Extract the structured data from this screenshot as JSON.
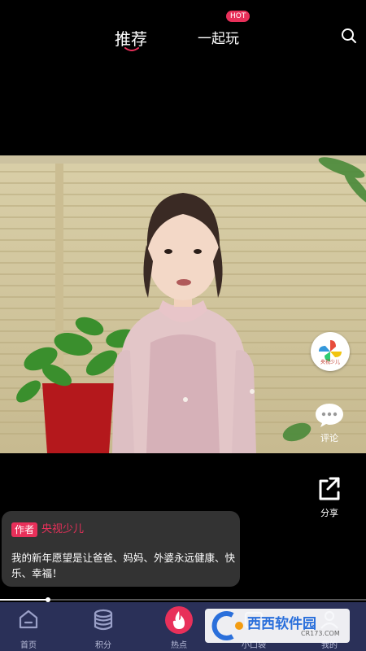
{
  "header": {
    "tabs": [
      {
        "label": "推荐",
        "active": true
      },
      {
        "label": "一起玩",
        "badge": "HOT"
      }
    ]
  },
  "side_actions": {
    "logo_text": "央视少儿",
    "comment_label": "评论",
    "share_label": "分享"
  },
  "caption": {
    "author_tag": "作者",
    "author_name": "央视少儿",
    "text": "我的新年愿望是让爸爸、妈妈、外婆永远健康、快乐、幸福！"
  },
  "playback": {
    "progress": 0.13
  },
  "bottom_nav": {
    "items": [
      {
        "label": "首页",
        "icon": "home-icon"
      },
      {
        "label": "积分",
        "icon": "coins-icon"
      },
      {
        "label": "热点",
        "icon": "fire-icon"
      },
      {
        "label": "小口袋",
        "icon": "pocket-icon"
      },
      {
        "label": "我的",
        "icon": "user-icon"
      }
    ]
  },
  "watermark": {
    "main": "西西软件园",
    "sub": "CR173.COM"
  },
  "colors": {
    "accent": "#e8305a",
    "nav_bg": "#2a3058"
  }
}
